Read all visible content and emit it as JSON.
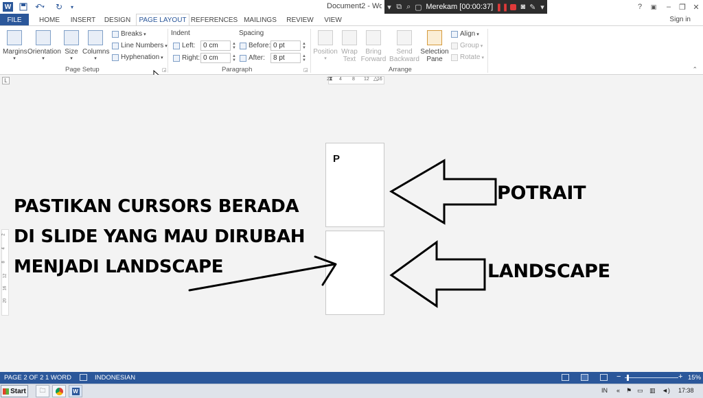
{
  "titlebar": {
    "doc_title": "Document2 - Word",
    "recorder_text": "Merekam [00:00:37]",
    "help": "?",
    "minimize": "–",
    "restore": "❐",
    "close": "✕"
  },
  "tabs": [
    {
      "id": "file",
      "label": "FILE"
    },
    {
      "id": "home",
      "label": "HOME"
    },
    {
      "id": "insert",
      "label": "INSERT"
    },
    {
      "id": "design",
      "label": "DESIGN"
    },
    {
      "id": "layout",
      "label": "PAGE LAYOUT"
    },
    {
      "id": "references",
      "label": "REFERENCES"
    },
    {
      "id": "mailings",
      "label": "MAILINGS"
    },
    {
      "id": "review",
      "label": "REVIEW"
    },
    {
      "id": "view",
      "label": "VIEW"
    }
  ],
  "signin": "Sign in",
  "ribbon": {
    "page_setup": {
      "margins": "Margins",
      "orientation": "Orientation",
      "size": "Size",
      "columns": "Columns",
      "breaks": "Breaks",
      "line_numbers": "Line Numbers",
      "hyphenation": "Hyphenation",
      "group_label": "Page Setup"
    },
    "paragraph": {
      "indent_label": "Indent",
      "left_label": "Left:",
      "left_value": "0 cm",
      "right_label": "Right:",
      "right_value": "0 cm",
      "spacing_label": "Spacing",
      "before_label": "Before:",
      "before_value": "0 pt",
      "after_label": "After:",
      "after_value": "8 pt",
      "group_label": "Paragraph"
    },
    "arrange": {
      "position": "Position",
      "wrap_text_1": "Wrap",
      "wrap_text_2": "Text",
      "bring_forward_1": "Bring",
      "bring_forward_2": "Forward",
      "send_backward_1": "Send",
      "send_backward_2": "Backward",
      "selection_pane_1": "Selection",
      "selection_pane_2": "Pane",
      "align": "Align",
      "group": "Group",
      "rotate": "Rotate",
      "group_label": "Arrange"
    }
  },
  "ruler": {
    "corner": "L",
    "ticks": [
      "2",
      "4",
      "8",
      "12",
      "16"
    ],
    "vticks": [
      "2",
      "4",
      "8",
      "12",
      "16",
      "20"
    ]
  },
  "document": {
    "page1_letter": "P"
  },
  "overlay": {
    "line1": "PASTIKAN CURSORS BERADA",
    "line2": "DI SLIDE YANG MAU DIRUBAH",
    "line3": "MENJADI LANDSCAPE",
    "potrait": "POTRAIT",
    "landscape": "LANDSCAPE"
  },
  "statusbar": {
    "page": "PAGE 2 OF 2",
    "words": "1 WORD",
    "language": "INDONESIAN",
    "zoom_minus": "−",
    "zoom_plus": "+",
    "zoom": "15%",
    "zoom_level": 0.05
  },
  "taskbar": {
    "start": "Start",
    "lang": "IN",
    "time": "17:38"
  }
}
